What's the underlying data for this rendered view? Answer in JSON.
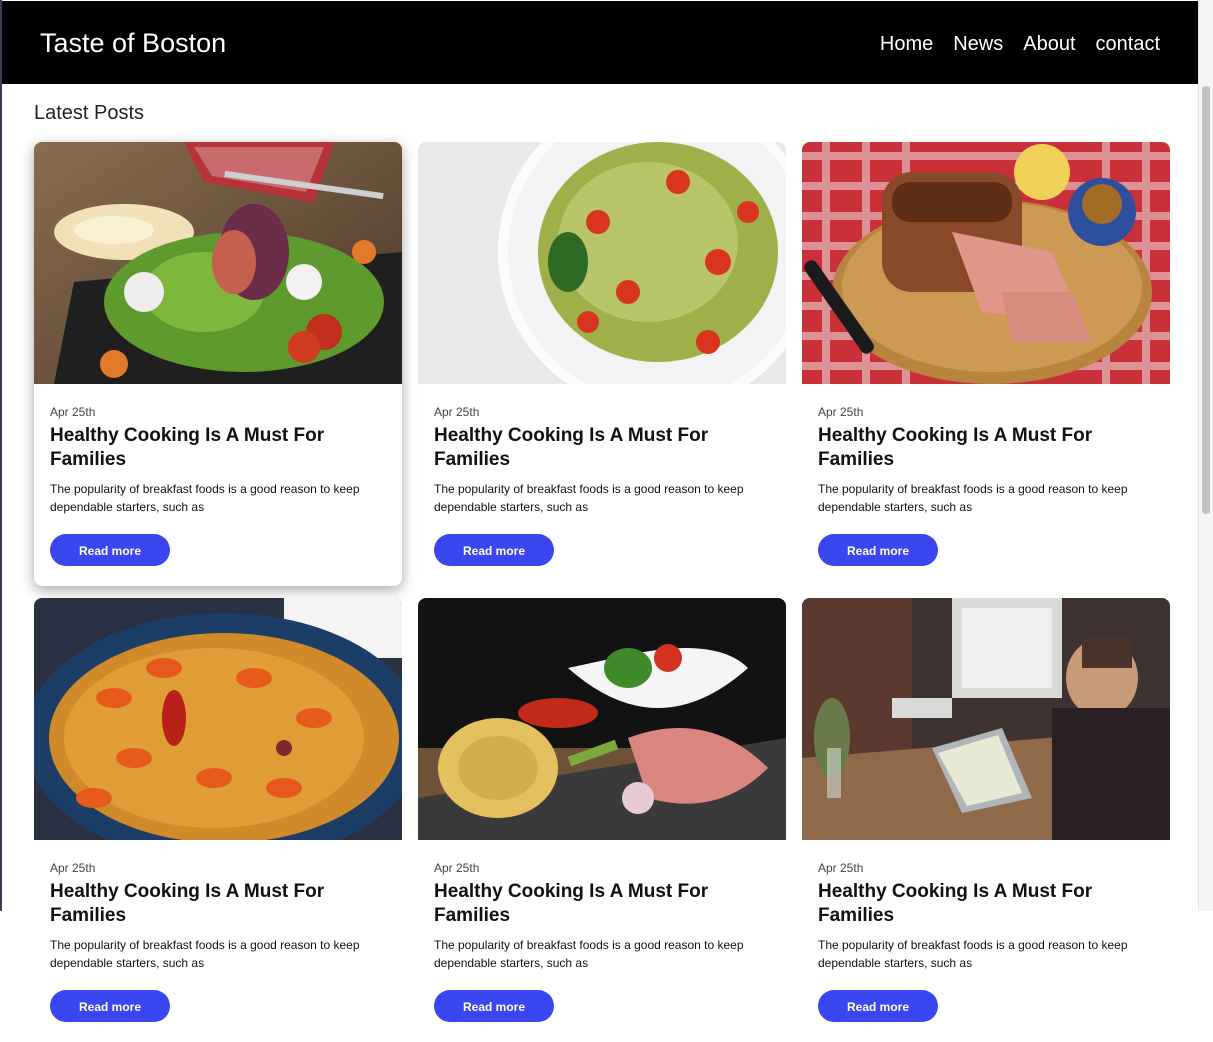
{
  "header": {
    "brand": "Taste of Boston",
    "nav": [
      "Home",
      "News",
      "About",
      "contact"
    ]
  },
  "main": {
    "section_title": "Latest Posts",
    "posts": [
      {
        "date": "Apr 25th",
        "title": "Healthy Cooking Is A Must For Families",
        "excerpt": "The popularity of breakfast foods is a good reason to keep dependable starters, such as",
        "button": "Read more",
        "image": "salad-with-figs-photo"
      },
      {
        "date": "Apr 25th",
        "title": "Healthy Cooking Is A Must For Families",
        "excerpt": "The popularity of breakfast foods is a good reason to keep dependable starters, such as",
        "button": "Read more",
        "image": "pesto-pasta-photo"
      },
      {
        "date": "Apr 25th",
        "title": "Healthy Cooking Is A Must For Families",
        "excerpt": "The popularity of breakfast foods is a good reason to keep dependable starters, such as",
        "button": "Read more",
        "image": "meatloaf-board-photo"
      },
      {
        "date": "Apr 25th",
        "title": "Healthy Cooking Is A Must For Families",
        "excerpt": "The popularity of breakfast foods is a good reason to keep dependable starters, such as",
        "button": "Read more",
        "image": "paella-pot-photo"
      },
      {
        "date": "Apr 25th",
        "title": "Healthy Cooking Is A Must For Families",
        "excerpt": "The popularity of breakfast foods is a good reason to keep dependable starters, such as",
        "button": "Read more",
        "image": "pasta-and-ham-photo"
      },
      {
        "date": "Apr 25th",
        "title": "Healthy Cooking Is A Must For Families",
        "excerpt": "The popularity of breakfast foods is a good reason to keep dependable starters, such as",
        "button": "Read more",
        "image": "man-with-laptop-photo"
      }
    ]
  },
  "colors": {
    "navbar": "#000000",
    "button": "#3a47f0"
  }
}
